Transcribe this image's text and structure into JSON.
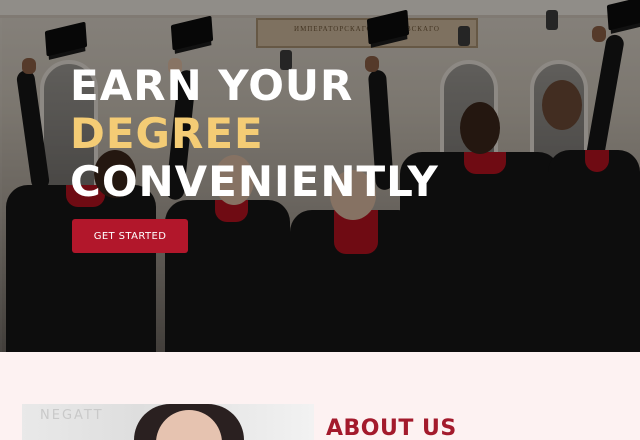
{
  "hero": {
    "headline_line1": "EARN YOUR",
    "headline_line2": "DEGREE",
    "headline_line3": "CONVENIENTLY",
    "cta_label": "GET STARTED",
    "building_sign": "ИМПЕРАТОРСКАГО МОСКОВСКАГО",
    "colors": {
      "accent_gold": "#f4cc75",
      "cta_red": "#b2172b"
    }
  },
  "about": {
    "title": "ABOUT US",
    "photo_text": "NEGATT",
    "title_color": "#a31a2c"
  }
}
